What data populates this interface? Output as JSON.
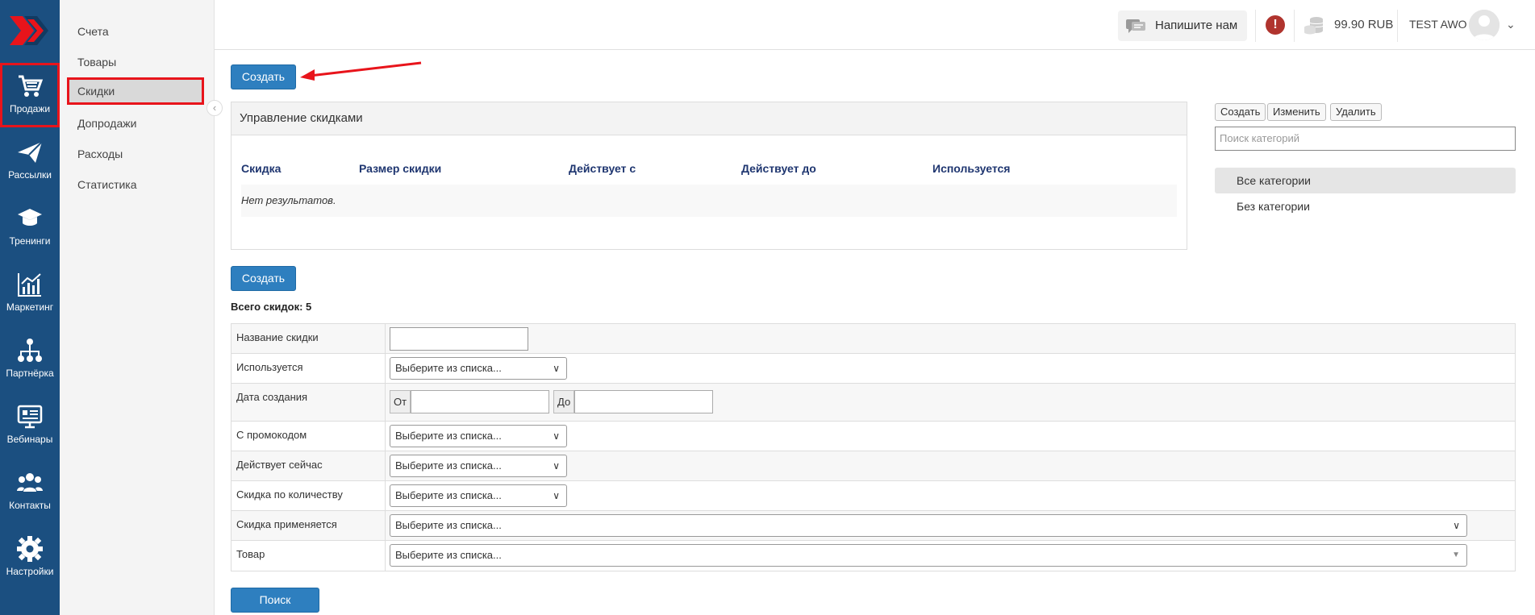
{
  "rail": {
    "items": [
      {
        "label": "Продажи",
        "icon": "cart-icon"
      },
      {
        "label": "Рассылки",
        "icon": "paper-plane-icon"
      },
      {
        "label": "Тренинги",
        "icon": "graduation-cap-icon"
      },
      {
        "label": "Маркетинг",
        "icon": "chart-icon"
      },
      {
        "label": "Партнёрка",
        "icon": "hierarchy-icon"
      },
      {
        "label": "Вебинары",
        "icon": "monitor-icon"
      },
      {
        "label": "Контакты",
        "icon": "users-icon"
      },
      {
        "label": "Настройки",
        "icon": "gear-icon"
      }
    ],
    "active": "Продажи"
  },
  "subnav": {
    "items": [
      "Счета",
      "Товары",
      "Скидки",
      "Допродажи",
      "Расходы",
      "Статистика"
    ],
    "active": "Скидки"
  },
  "topbar": {
    "write_label": "Напишите нам",
    "balance": "99.90 RUB",
    "user_name": "TEST AWO"
  },
  "actions": {
    "create_top": "Создать",
    "create_bottom": "Создать",
    "search": "Поиск"
  },
  "panel": {
    "title": "Управление скидками",
    "columns": [
      "Скидка",
      "Размер скидки",
      "Действует с",
      "Действует до",
      "Используется"
    ],
    "empty": "Нет результатов."
  },
  "categories": {
    "buttons": [
      "Создать",
      "Изменить",
      "Удалить"
    ],
    "search_placeholder": "Поиск категорий",
    "items": [
      "Все категории",
      "Без категории"
    ]
  },
  "filters": {
    "total": "Всего скидок: 5",
    "select_placeholder": "Выберите из списка...",
    "rows": [
      "Название скидки",
      "Используется",
      "Дата создания",
      "С промокодом",
      "Действует сейчас",
      "Скидка по количеству",
      "Скидка применяется",
      "Товар"
    ],
    "date_from": "От",
    "date_to": "До"
  },
  "colors": {
    "rail_bg": "#1b4f80",
    "primary": "#2e7fbf",
    "highlight": "#e8141b"
  }
}
